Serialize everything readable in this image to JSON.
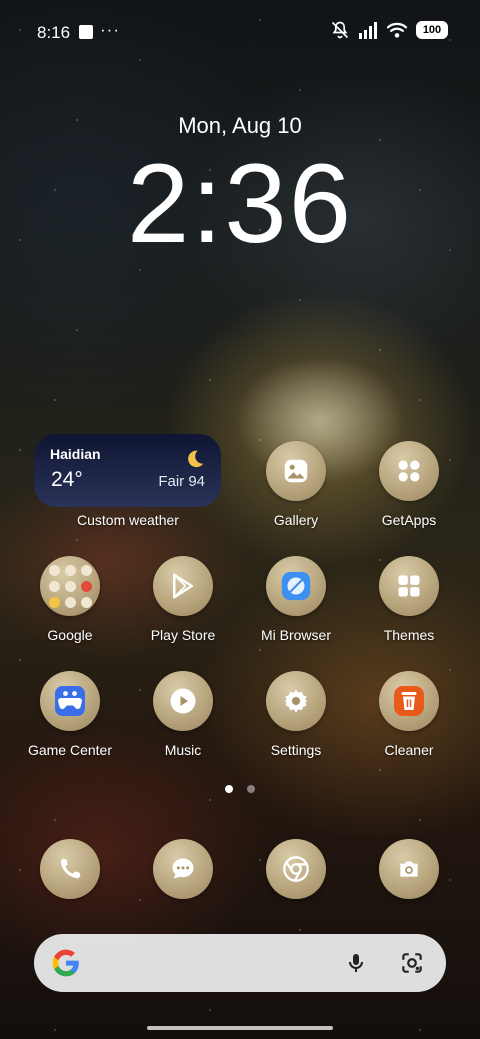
{
  "status_bar": {
    "time": "8:16",
    "overflow": "···",
    "battery": "100",
    "icons": [
      "silent-bell-icon",
      "signal-icon",
      "wifi-icon"
    ]
  },
  "lockclock": {
    "date": "Mon, Aug 10",
    "time": "2:36"
  },
  "weather_widget": {
    "city": "Haidian",
    "temperature": "24°",
    "condition": "Fair 94",
    "label": "Custom weather",
    "icon": "crescent-moon-icon"
  },
  "apps": [
    {
      "name": "Gallery",
      "icon": "gallery-icon"
    },
    {
      "name": "GetApps",
      "icon": "getapps-icon"
    },
    {
      "name": "Google",
      "icon": "folder-icon"
    },
    {
      "name": "Play Store",
      "icon": "play-store-icon"
    },
    {
      "name": "Mi Browser",
      "icon": "browser-icon"
    },
    {
      "name": "Themes",
      "icon": "themes-icon"
    },
    {
      "name": "Game Center",
      "icon": "game-controller-icon"
    },
    {
      "name": "Music",
      "icon": "music-play-icon"
    },
    {
      "name": "Settings",
      "icon": "gear-icon"
    },
    {
      "name": "Cleaner",
      "icon": "trash-icon"
    }
  ],
  "pager": {
    "pages": 2,
    "active": 1
  },
  "dock": [
    {
      "name": "Phone",
      "icon": "phone-icon"
    },
    {
      "name": "Messages",
      "icon": "chat-bubble-icon"
    },
    {
      "name": "Chrome",
      "icon": "chrome-icon"
    },
    {
      "name": "Camera",
      "icon": "camera-icon"
    }
  ],
  "search_bar": {
    "logo": "G",
    "icons": [
      "microphone-icon",
      "google-lens-icon"
    ]
  },
  "colors": {
    "icon_bg": "#b5a27a",
    "widget_bg": "#1c2245",
    "cleaner_accent": "#e85a1a",
    "browser_accent": "#3d8ff0",
    "game_accent": "#3a6de8"
  }
}
